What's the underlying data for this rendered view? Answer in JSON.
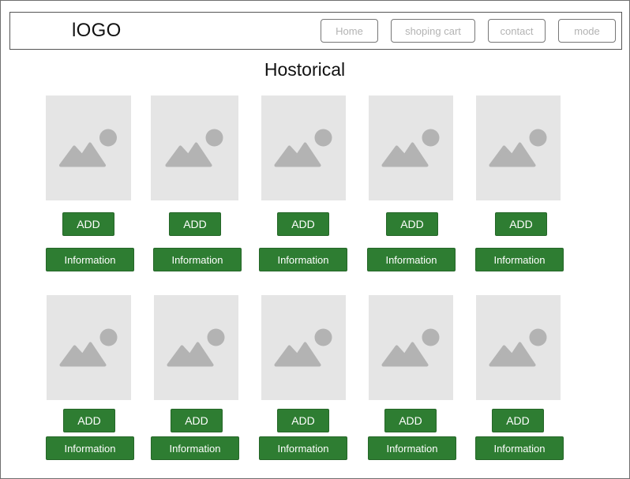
{
  "header": {
    "logo": "lOGO",
    "nav": [
      {
        "label": "Home"
      },
      {
        "label": "shoping cart"
      },
      {
        "label": "contact"
      },
      {
        "label": "mode"
      }
    ]
  },
  "page_title": "Hostorical",
  "products": [
    {
      "image_icon": "image-placeholder-icon",
      "add_label": "ADD",
      "info_label": "Information"
    },
    {
      "image_icon": "image-placeholder-icon",
      "add_label": "ADD",
      "info_label": "Information"
    },
    {
      "image_icon": "image-placeholder-icon",
      "add_label": "ADD",
      "info_label": "Information"
    },
    {
      "image_icon": "image-placeholder-icon",
      "add_label": "ADD",
      "info_label": "Information"
    },
    {
      "image_icon": "image-placeholder-icon",
      "add_label": "ADD",
      "info_label": "Information"
    },
    {
      "image_icon": "image-placeholder-icon",
      "add_label": "ADD",
      "info_label": "Information"
    },
    {
      "image_icon": "image-placeholder-icon",
      "add_label": "ADD",
      "info_label": "Information"
    },
    {
      "image_icon": "image-placeholder-icon",
      "add_label": "ADD",
      "info_label": "Information"
    },
    {
      "image_icon": "image-placeholder-icon",
      "add_label": "ADD",
      "info_label": "Information"
    },
    {
      "image_icon": "image-placeholder-icon",
      "add_label": "ADD",
      "info_label": "Information"
    }
  ],
  "colors": {
    "button_green": "#2e7d32",
    "placeholder_bg": "#e5e5e5",
    "placeholder_icon": "#b3b3b3",
    "nav_text": "#b3b3b3"
  }
}
